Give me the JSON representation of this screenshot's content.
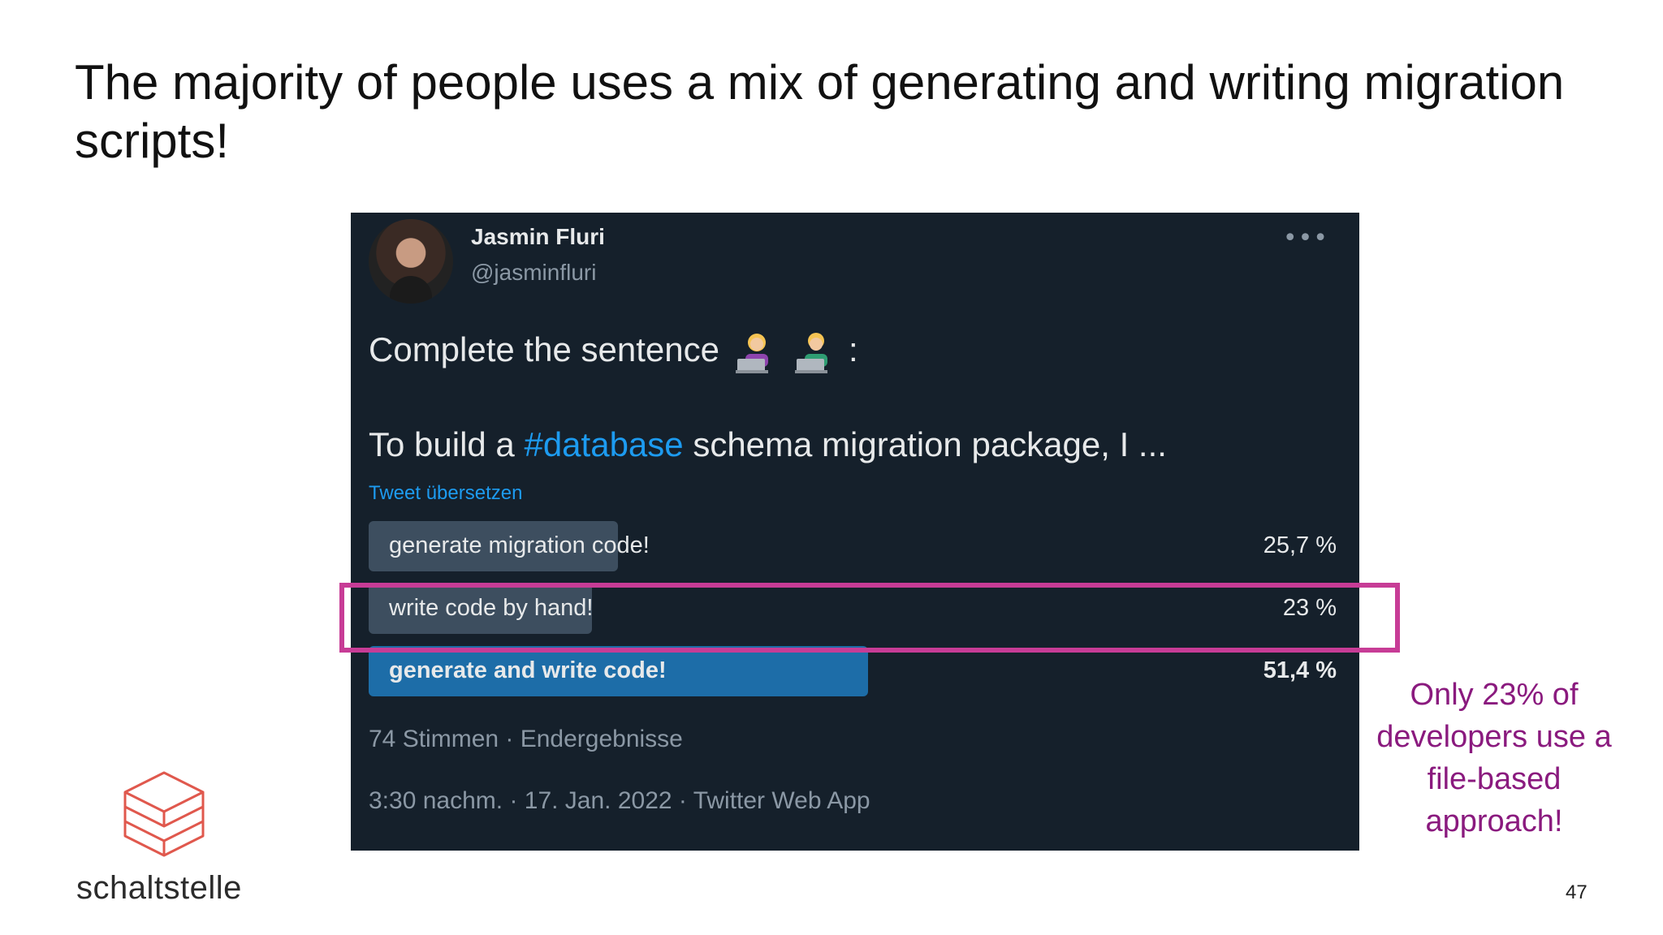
{
  "slide": {
    "title": "The majority of people uses a mix of generating and writing migration scripts!",
    "page_number": "47",
    "annotation": "Only 23% of developers use a file-based approach!",
    "logo_text": "schaltstelle",
    "highlight_color": "#c73c96",
    "annotation_color": "#8a1a7e"
  },
  "tweet": {
    "author_name": "Jasmin Fluri",
    "author_handle": "@jasminfluri",
    "more_icon": "ellipsis-icon",
    "line1": "Complete the sentence",
    "line1_suffix": ":",
    "line2_prefix": "To build a ",
    "hashtag": "#database",
    "line2_suffix": " schema migration package, I ...",
    "translate_link": "Tweet übersetzen",
    "poll": [
      {
        "label": "generate migration code!",
        "percent_text": "25,7 %",
        "percent": 25.7,
        "winner": false
      },
      {
        "label": "write code by hand!",
        "percent_text": "23 %",
        "percent": 23,
        "winner": false
      },
      {
        "label": "generate and write code!",
        "percent_text": "51,4 %",
        "percent": 51.4,
        "winner": true
      }
    ],
    "votes_text": "74 Stimmen · Endergebnisse",
    "meta_text": "3:30 nachm. · 17. Jan. 2022 · Twitter Web App",
    "colors": {
      "background": "#15202b",
      "link": "#1d9bf0",
      "bar": "#3d4e5f",
      "winner_bar": "#1d6da8"
    }
  }
}
